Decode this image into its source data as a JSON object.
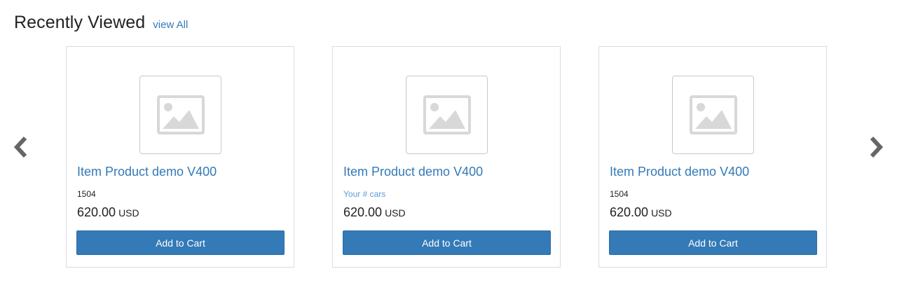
{
  "header": {
    "title": "Recently Viewed",
    "view_all": "view All"
  },
  "nav": {
    "prev_icon": "chevron-left-icon",
    "next_icon": "chevron-right-icon",
    "arrow_color": "#666666"
  },
  "colors": {
    "accent": "#337ab7",
    "placeholder_gray": "#d8d8d8"
  },
  "products": [
    {
      "name": "Item Product demo V400",
      "subtext": "1504",
      "subtext_is_link": false,
      "price": "620.00",
      "currency": "USD",
      "button": "Add to Cart"
    },
    {
      "name": "Item Product demo V400",
      "subtext": "Your # cars",
      "subtext_is_link": true,
      "price": "620.00",
      "currency": "USD",
      "button": "Add to Cart"
    },
    {
      "name": "Item Product demo V400",
      "subtext": "1504",
      "subtext_is_link": false,
      "price": "620.00",
      "currency": "USD",
      "button": "Add to Cart"
    }
  ]
}
